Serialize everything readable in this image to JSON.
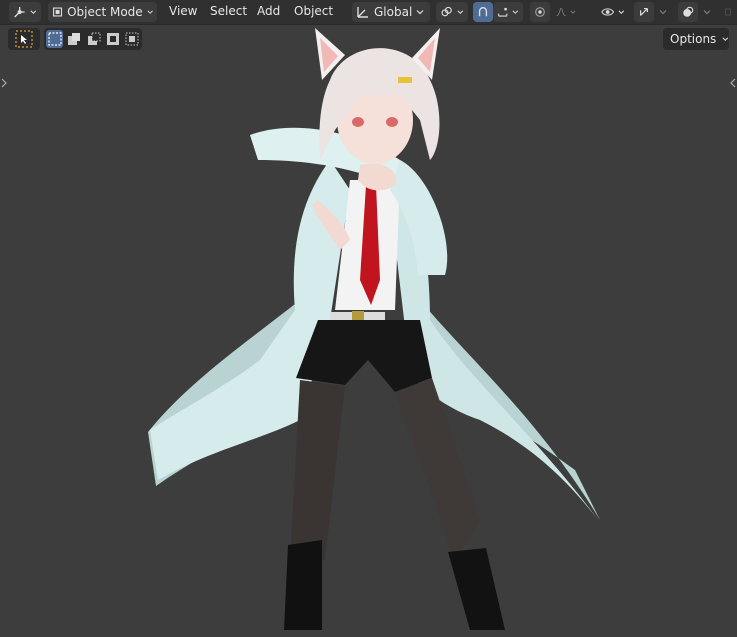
{
  "header": {
    "editor_type_icon": "viewport-icon",
    "mode": "Object Mode",
    "menus": [
      "View",
      "Select",
      "Add",
      "Object"
    ],
    "orientation": "Global",
    "right_icons": [
      "pivot-icon",
      "snap-icon",
      "snap-target-icon",
      "proportional-edit-icon",
      "falloff-icon",
      "visibility-icon",
      "gizmo-icon",
      "overlay-icon"
    ]
  },
  "toolbar": {
    "tool_icon": "select-box-icon",
    "selection_modes": [
      "select-new-icon",
      "select-extend-icon",
      "select-subtract-icon",
      "select-invert-icon",
      "select-intersect-icon"
    ]
  },
  "options": {
    "label": "Options"
  },
  "colors": {
    "viewport_bg": "#3d3d3d",
    "header_bg": "#303030",
    "active_accent": "#4f6d94",
    "coat": "#d6ecec",
    "tie": "#c0141e",
    "hair": "#ece4e2"
  }
}
